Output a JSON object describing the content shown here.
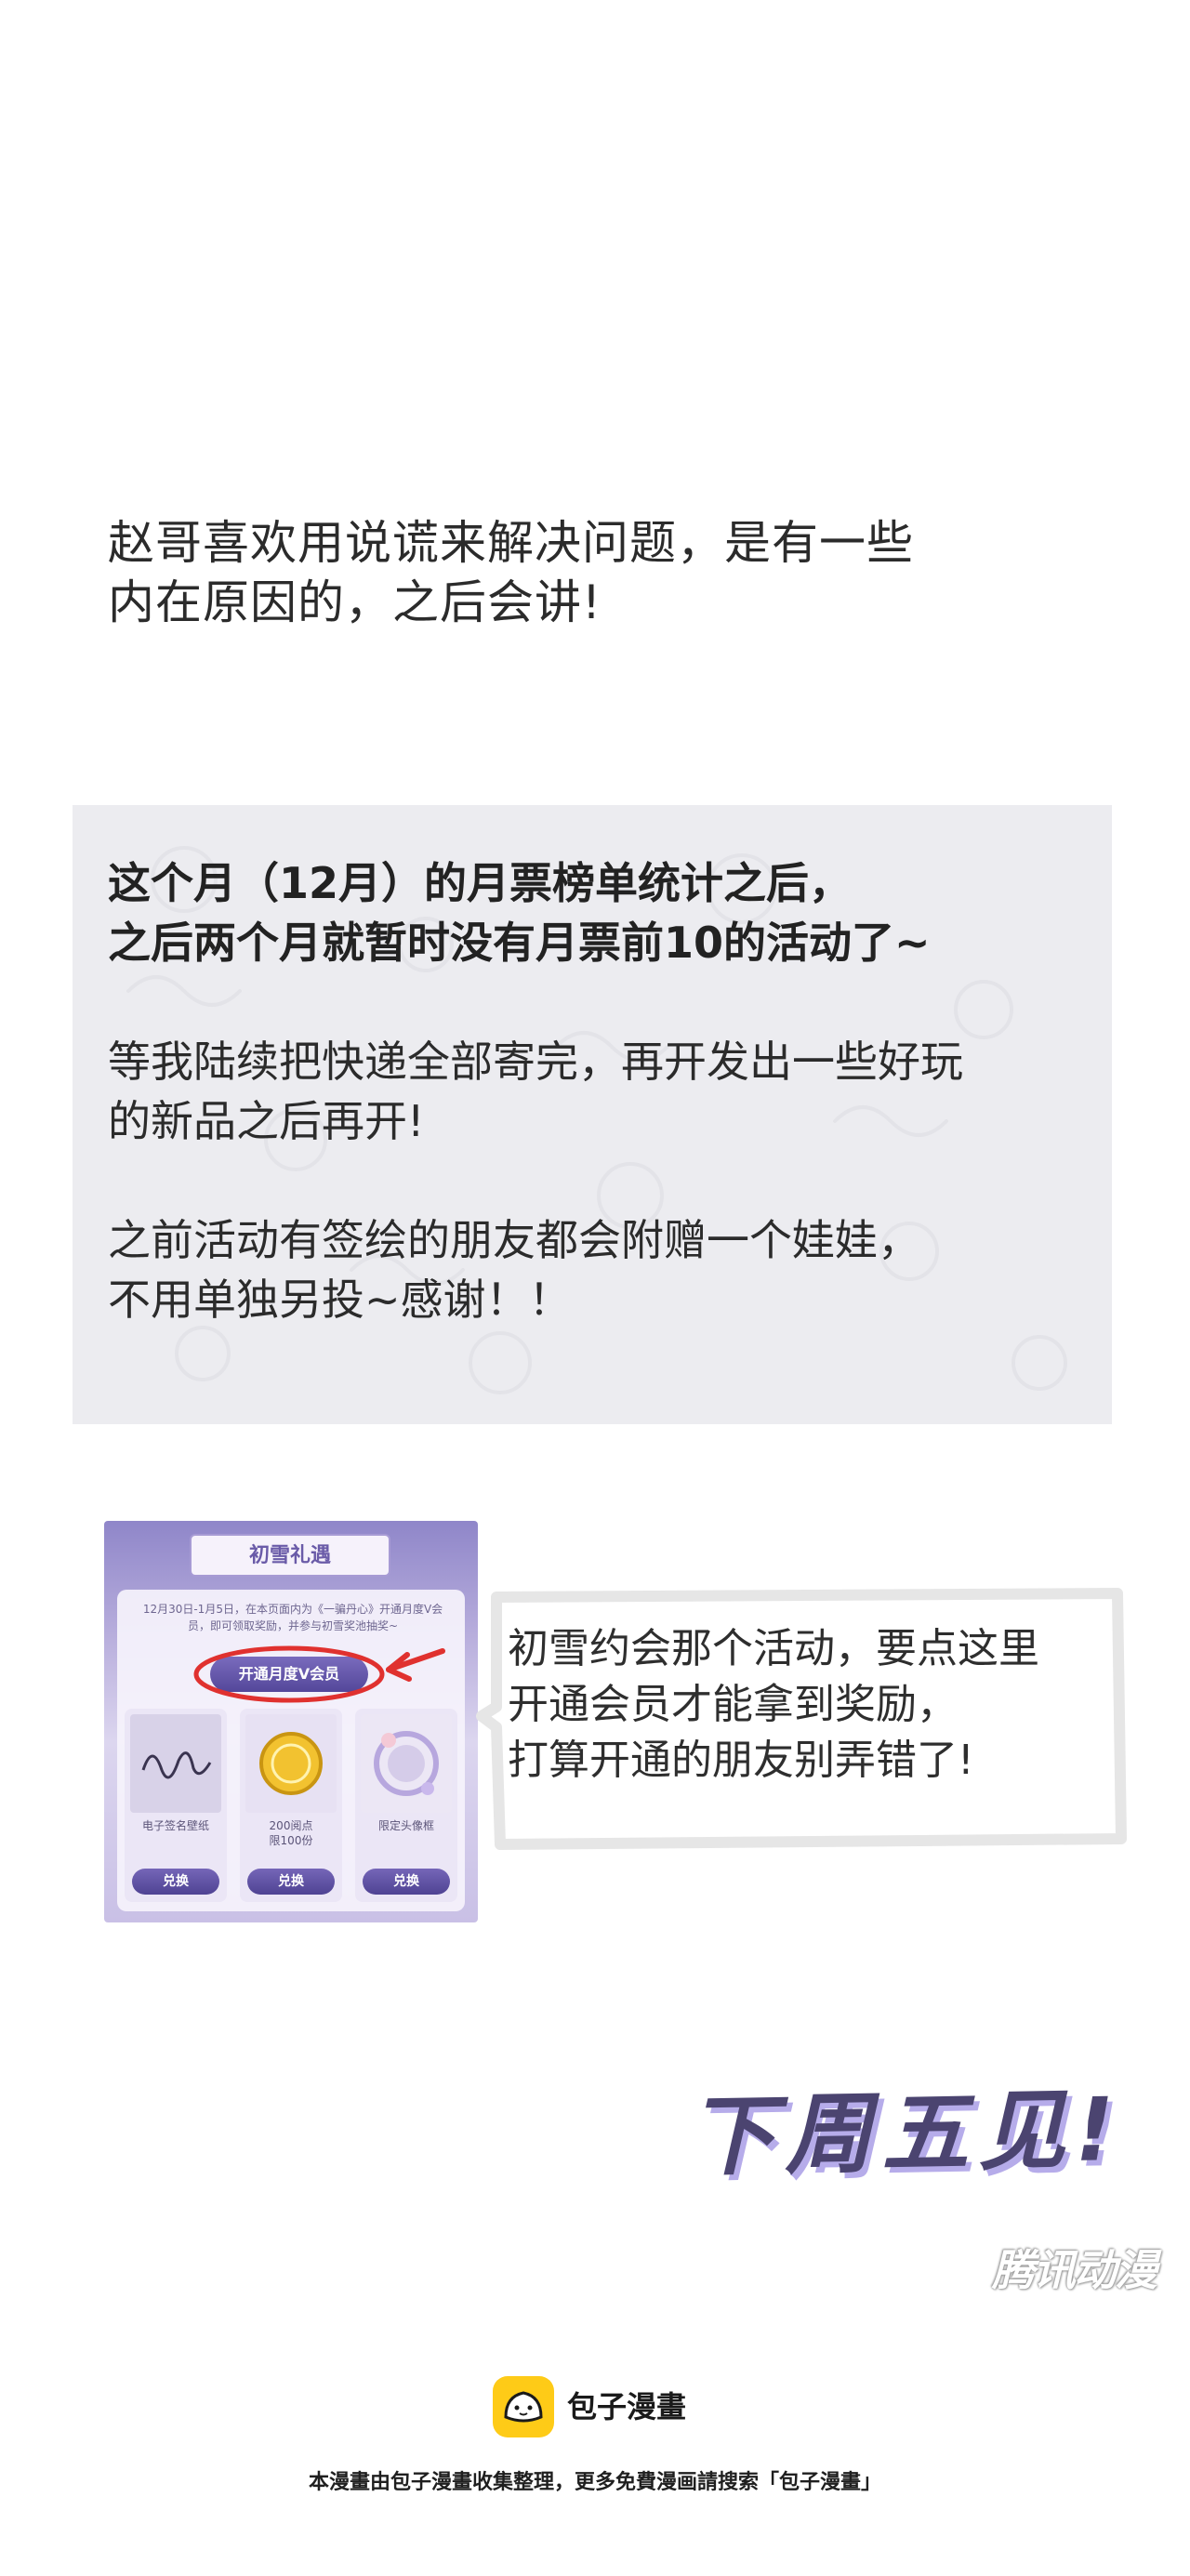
{
  "intro": {
    "lines": [
      "赵哥喜欢用说谎来解决问题，是有一些",
      "内在原因的，之后会讲!"
    ]
  },
  "notice": {
    "bold_lines": [
      "这个月（12月）的月票榜单统计之后，",
      "之后两个月就暂时没有月票前10的活动了~"
    ],
    "para2": [
      "等我陆续把快递全部寄完，再开发出一些好玩",
      "的新品之后再开!"
    ],
    "para3": [
      "之前活动有签绘的朋友都会附赠一个娃娃，",
      "不用单独另投~感谢！！"
    ]
  },
  "promo": {
    "title": "初雪礼遇",
    "desc": "12月30日-1月5日，在本页面内为《一骗丹心》开通月度V会员，即可领取奖励，并参与初雪奖池抽奖~",
    "button": "开通月度V会员",
    "items": [
      {
        "caption": "电子签名壁纸",
        "action": "兑换"
      },
      {
        "caption": "200阅点\n限100份",
        "action": "兑换"
      },
      {
        "caption": "限定头像框",
        "action": "兑换"
      }
    ],
    "colors": {
      "accent": "#54479a",
      "highlight": "#e0312f"
    }
  },
  "bubble": {
    "lines": [
      "初雪约会那个活动，要点这里",
      "开通会员才能拿到奖励，",
      "打算开通的朋友别弄错了!"
    ]
  },
  "signoff": "下周五见!",
  "watermark": "腾讯动漫",
  "brand": {
    "name": "包子漫畫",
    "logo_icon": "bun-logo-icon",
    "color": "#fecb17"
  },
  "footer": "本漫畫由包子漫畫收集整理，更多免費漫画請搜索「包子漫畫」"
}
